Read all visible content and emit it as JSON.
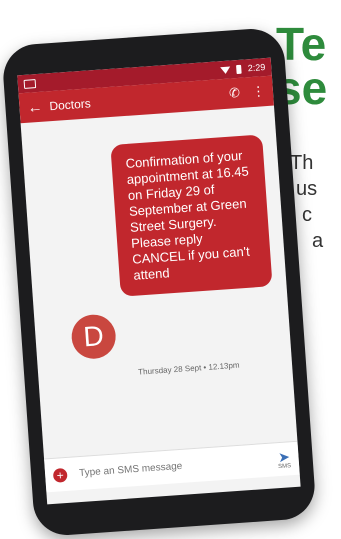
{
  "article": {
    "headline_lines": [
      "Te",
      "se"
    ],
    "body_lines": [
      "Th",
      "us",
      "c",
      "a"
    ]
  },
  "status_bar": {
    "time": "2:29"
  },
  "app_bar": {
    "title": "Doctors"
  },
  "message": {
    "text": "Confirmation of your appointment at 16.45 on Friday 29 of September at Green Street Surgery. Please reply CANCEL if you can't attend",
    "sender_initial": "D",
    "timestamp": "Thursday 28 Sept • 12.13pm"
  },
  "composer": {
    "placeholder": "Type an SMS message",
    "send_label": "SMS"
  },
  "colors": {
    "accent": "#c1272d",
    "status_bar": "#a41b2b",
    "headline": "#2e8b3c"
  }
}
